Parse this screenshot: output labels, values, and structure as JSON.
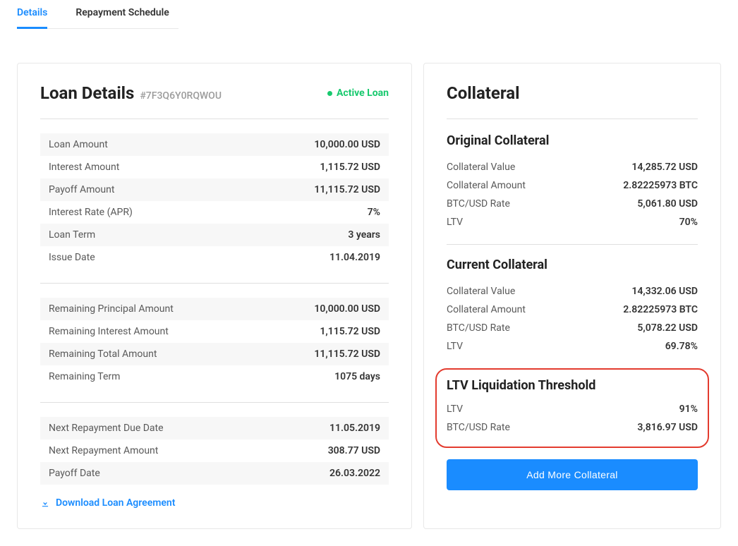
{
  "tabs": {
    "details": "Details",
    "repayment": "Repayment Schedule"
  },
  "loan": {
    "title": "Loan Details",
    "id": "#7F3Q6Y0RQWOU",
    "status": "Active Loan",
    "rows1": [
      {
        "label": "Loan Amount",
        "value": "10,000.00 USD"
      },
      {
        "label": "Interest Amount",
        "value": "1,115.72 USD"
      },
      {
        "label": "Payoff Amount",
        "value": "11,115.72 USD"
      },
      {
        "label": "Interest Rate (APR)",
        "value": "7%"
      },
      {
        "label": "Loan Term",
        "value": "3 years"
      },
      {
        "label": "Issue Date",
        "value": "11.04.2019"
      }
    ],
    "rows2": [
      {
        "label": "Remaining Principal Amount",
        "value": "10,000.00 USD"
      },
      {
        "label": "Remaining Interest Amount",
        "value": "1,115.72 USD"
      },
      {
        "label": "Remaining Total Amount",
        "value": "11,115.72 USD"
      },
      {
        "label": "Remaining Term",
        "value": "1075 days"
      }
    ],
    "rows3": [
      {
        "label": "Next Repayment Due Date",
        "value": "11.05.2019"
      },
      {
        "label": "Next Repayment Amount",
        "value": "308.77 USD"
      },
      {
        "label": "Payoff Date",
        "value": "26.03.2022"
      }
    ],
    "download": "Download Loan Agreement"
  },
  "collateral": {
    "title": "Collateral",
    "original": {
      "title": "Original Collateral",
      "rows": [
        {
          "label": "Collateral Value",
          "value": "14,285.72 USD"
        },
        {
          "label": "Collateral Amount",
          "value": "2.82225973 BTC"
        },
        {
          "label": "BTC/USD Rate",
          "value": "5,061.80 USD"
        },
        {
          "label": "LTV",
          "value": "70%"
        }
      ]
    },
    "current": {
      "title": "Current Collateral",
      "rows": [
        {
          "label": "Collateral Value",
          "value": "14,332.06 USD"
        },
        {
          "label": "Collateral Amount",
          "value": "2.82225973 BTC"
        },
        {
          "label": "BTC/USD Rate",
          "value": "5,078.22 USD"
        },
        {
          "label": "LTV",
          "value": "69.78%"
        }
      ]
    },
    "liquidation": {
      "title": "LTV Liquidation Threshold",
      "rows": [
        {
          "label": "LTV",
          "value": "91%"
        },
        {
          "label": "BTC/USD Rate",
          "value": "3,816.97 USD"
        }
      ]
    },
    "add_button": "Add More Collateral"
  }
}
